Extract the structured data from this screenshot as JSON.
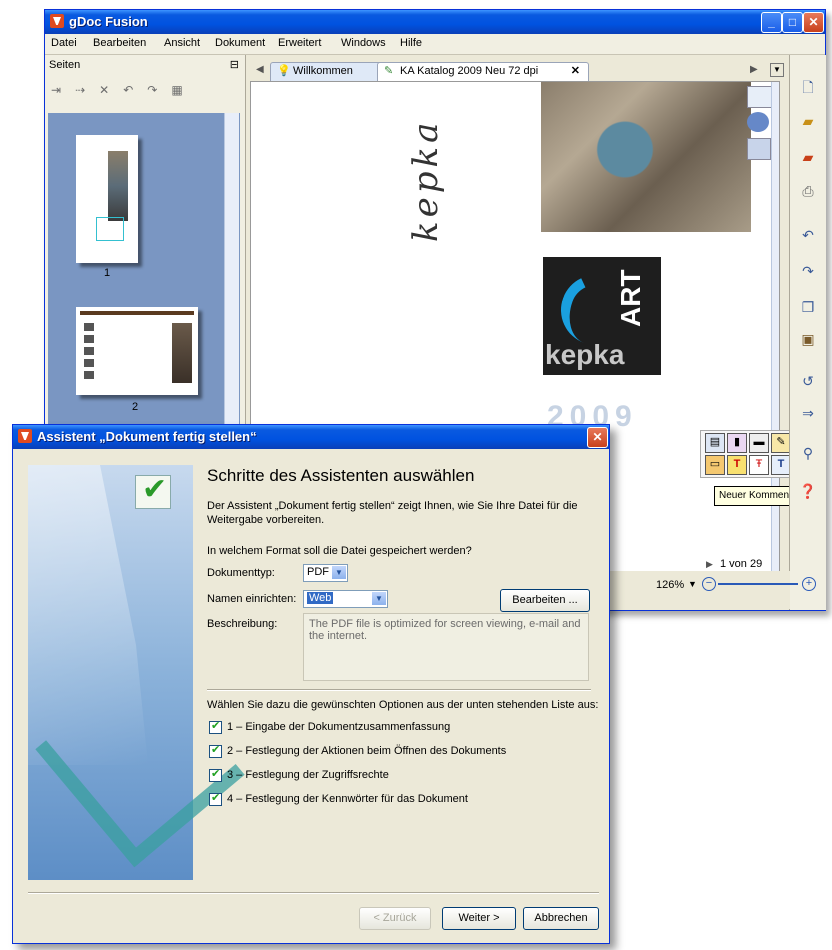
{
  "main_window": {
    "title": "gDoc Fusion",
    "menu": [
      "Datei",
      "Bearbeiten",
      "Ansicht",
      "Dokument",
      "Erweitert",
      "Windows",
      "Hilfe"
    ],
    "pages_panel": {
      "title": "Seiten",
      "thumbnails": [
        {
          "label": "1"
        },
        {
          "label": "2"
        }
      ]
    },
    "tabs": [
      "Willkommen",
      "KA Katalog 2009 Neu 72 dpi"
    ],
    "document": {
      "logo_word": "ART",
      "logo_brand": "kepka",
      "year": "2009",
      "script_text": "kepka"
    },
    "page_indicator": "1 von 29",
    "zoom": "126%",
    "tooltip": "Neuer Kommentar"
  },
  "dialog": {
    "title": "Assistent „Dokument fertig stellen“",
    "heading": "Schritte des Assistenten auswählen",
    "intro": "Der Assistent „Dokument fertig stellen“ zeigt Ihnen, wie Sie Ihre Datei für die Weitergabe vorbereiten.",
    "format_question": "In welchem Format soll die Datei gespeichert werden?",
    "doctype_label": "Dokumenttyp:",
    "doctype_value": "PDF",
    "naming_label": "Namen einrichten:",
    "naming_value": "Web",
    "edit_button": "Bearbeiten ...",
    "description_label": "Beschreibung:",
    "description_text": "The PDF file is optimized for screen viewing, e-mail and the internet.",
    "options_intro": "Wählen Sie dazu die gewünschten Optionen aus der unten stehenden Liste aus:",
    "options": [
      {
        "label": "1 – Eingabe der Dokumentzusammenfassung",
        "checked": true
      },
      {
        "label": "2 – Festlegung der Aktionen beim Öffnen des Dokuments",
        "checked": true
      },
      {
        "label": "3 – Festlegung der Zugriffsrechte",
        "checked": true
      },
      {
        "label": "4 – Festlegung der Kennwörter für das Dokument",
        "checked": true
      }
    ],
    "back_button": "< Zurück",
    "next_button": "Weiter >",
    "cancel_button": "Abbrechen"
  }
}
